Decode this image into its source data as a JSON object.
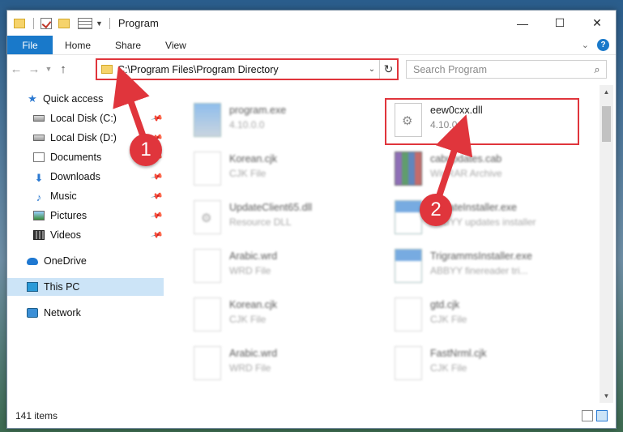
{
  "window": {
    "title": "Program",
    "controls": {
      "minimize": "—",
      "maximize": "☐",
      "close": "✕"
    }
  },
  "ribbon": {
    "file_tab": "File",
    "tabs": [
      "Home",
      "Share",
      "View"
    ],
    "help": "?"
  },
  "address_bar": {
    "path": "C:\\Program Files\\Program Directory",
    "search_placeholder": "Search Program"
  },
  "sidebar": {
    "items": [
      {
        "label": "Quick access",
        "icon": "star-icon",
        "pinned": false
      },
      {
        "label": "Local Disk (C:)",
        "icon": "disk-icon",
        "pinned": true
      },
      {
        "label": "Local Disk (D:)",
        "icon": "disk-icon",
        "pinned": true
      },
      {
        "label": "Documents",
        "icon": "documents-icon",
        "pinned": true
      },
      {
        "label": "Downloads",
        "icon": "downloads-icon",
        "pinned": true
      },
      {
        "label": "Music",
        "icon": "music-icon",
        "pinned": true
      },
      {
        "label": "Pictures",
        "icon": "pictures-icon",
        "pinned": true
      },
      {
        "label": "Videos",
        "icon": "videos-icon",
        "pinned": true
      },
      {
        "label": "OneDrive",
        "icon": "onedrive-icon",
        "pinned": false
      },
      {
        "label": "This PC",
        "icon": "this-pc-icon",
        "pinned": false,
        "selected": true
      },
      {
        "label": "Network",
        "icon": "network-icon",
        "pinned": false
      }
    ]
  },
  "files": [
    {
      "name": "program.exe",
      "detail": "4.10.0.0",
      "icon": "program-icon",
      "blurred": true
    },
    {
      "name": "eew0cxx.dll",
      "detail": "4.10.0.0",
      "icon": "dll-gear-icon",
      "blurred": false,
      "highlighted": true
    },
    {
      "name": "Korean.cjk",
      "detail": "CJK File",
      "icon": "blank-file-icon",
      "blurred": true
    },
    {
      "name": "cabupdates.cab",
      "detail": "WinRAR Archive",
      "icon": "rar-archive-icon",
      "blurred": true
    },
    {
      "name": "UpdateClient65.dll",
      "detail": "Resource DLL",
      "icon": "dll-gear-icon",
      "blurred": true
    },
    {
      "name": "UpdateInstaller.exe",
      "detail": "ABBYY updates installer",
      "icon": "exe-window-icon",
      "blurred": true
    },
    {
      "name": "Arabic.wrd",
      "detail": "WRD File",
      "icon": "blank-file-icon",
      "blurred": true
    },
    {
      "name": "TrigrammsInstaller.exe",
      "detail": "ABBYY finereader tri...",
      "icon": "exe-window-icon",
      "blurred": true
    },
    {
      "name": "Korean.cjk",
      "detail": "CJK File",
      "icon": "blank-file-icon",
      "blurred": true
    },
    {
      "name": "gtd.cjk",
      "detail": "CJK File",
      "icon": "blank-file-icon",
      "blurred": true
    },
    {
      "name": "Arabic.wrd",
      "detail": "WRD File",
      "icon": "blank-file-icon",
      "blurred": true
    },
    {
      "name": "FastNrml.cjk",
      "detail": "CJK File",
      "icon": "blank-file-icon",
      "blurred": true
    }
  ],
  "status_bar": {
    "item_count": "141 items"
  },
  "callouts": [
    {
      "number": "1",
      "target": "address-bar"
    },
    {
      "number": "2",
      "target": "eew0cxx.dll"
    }
  ],
  "colors": {
    "accent": "#1979ca",
    "callout": "#e0353c",
    "selection": "#cce4f7"
  }
}
